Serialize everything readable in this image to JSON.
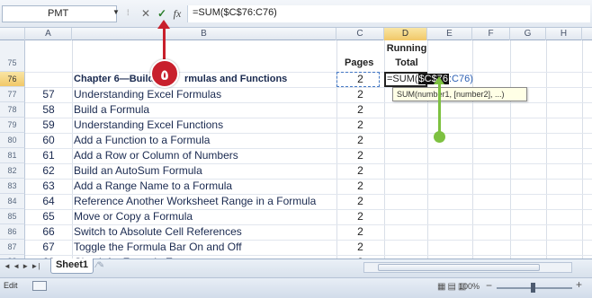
{
  "formula_bar": {
    "name_box": "PMT",
    "cancel_icon": "✕",
    "enter_icon": "✓",
    "fx_icon": "fx",
    "formula": "=SUM($C$76:C76)"
  },
  "columns": [
    "A",
    "B",
    "C",
    "D",
    "E",
    "F",
    "G",
    "H"
  ],
  "header_row": {
    "row": "75",
    "pages_label": "Pages",
    "running_total_line1": "Running",
    "running_total_line2": "Total"
  },
  "title_row": {
    "row": "76",
    "title": "Chapter 6—Build",
    "title_rest": "rmulas and Functions",
    "pages": "2",
    "edit_prefix": "=SUM(",
    "edit_highlight": "$C$76",
    "edit_suffix": ":C76)"
  },
  "tooltip": "SUM(number1, [number2], ...)",
  "rows": [
    {
      "row": "77",
      "num": "57",
      "title": "Understanding Excel Formulas",
      "pages": "2"
    },
    {
      "row": "78",
      "num": "58",
      "title": "Build a Formula",
      "pages": "2"
    },
    {
      "row": "79",
      "num": "59",
      "title": "Understanding Excel Functions",
      "pages": "2"
    },
    {
      "row": "80",
      "num": "60",
      "title": "Add a Function to a Formula",
      "pages": "2"
    },
    {
      "row": "81",
      "num": "61",
      "title": "Add a Row or Column of Numbers",
      "pages": "2"
    },
    {
      "row": "82",
      "num": "62",
      "title": "Build an AutoSum Formula",
      "pages": "2"
    },
    {
      "row": "83",
      "num": "63",
      "title": "Add a Range Name to a Formula",
      "pages": "2"
    },
    {
      "row": "84",
      "num": "64",
      "title": "Reference Another Worksheet Range in a Formula",
      "pages": "2"
    },
    {
      "row": "85",
      "num": "65",
      "title": "Move or Copy a Formula",
      "pages": "2"
    },
    {
      "row": "86",
      "num": "66",
      "title": "Switch to Absolute Cell References",
      "pages": "2"
    },
    {
      "row": "87",
      "num": "67",
      "title": "Toggle the Formula Bar On and Off",
      "pages": "2"
    },
    {
      "row": "88",
      "num": "68",
      "title": "Check for Formula Errors",
      "pages": "2"
    }
  ],
  "callout": {
    "step": "5",
    "color": "#c8202c",
    "glyph": "٥"
  },
  "green_color": "#7ec141",
  "sheet_tab": "Sheet1",
  "status": {
    "mode": "Edit",
    "zoom": "100%",
    "minus": "−",
    "plus": "+"
  },
  "nav_icons": "◄ ◄ ► ►|"
}
